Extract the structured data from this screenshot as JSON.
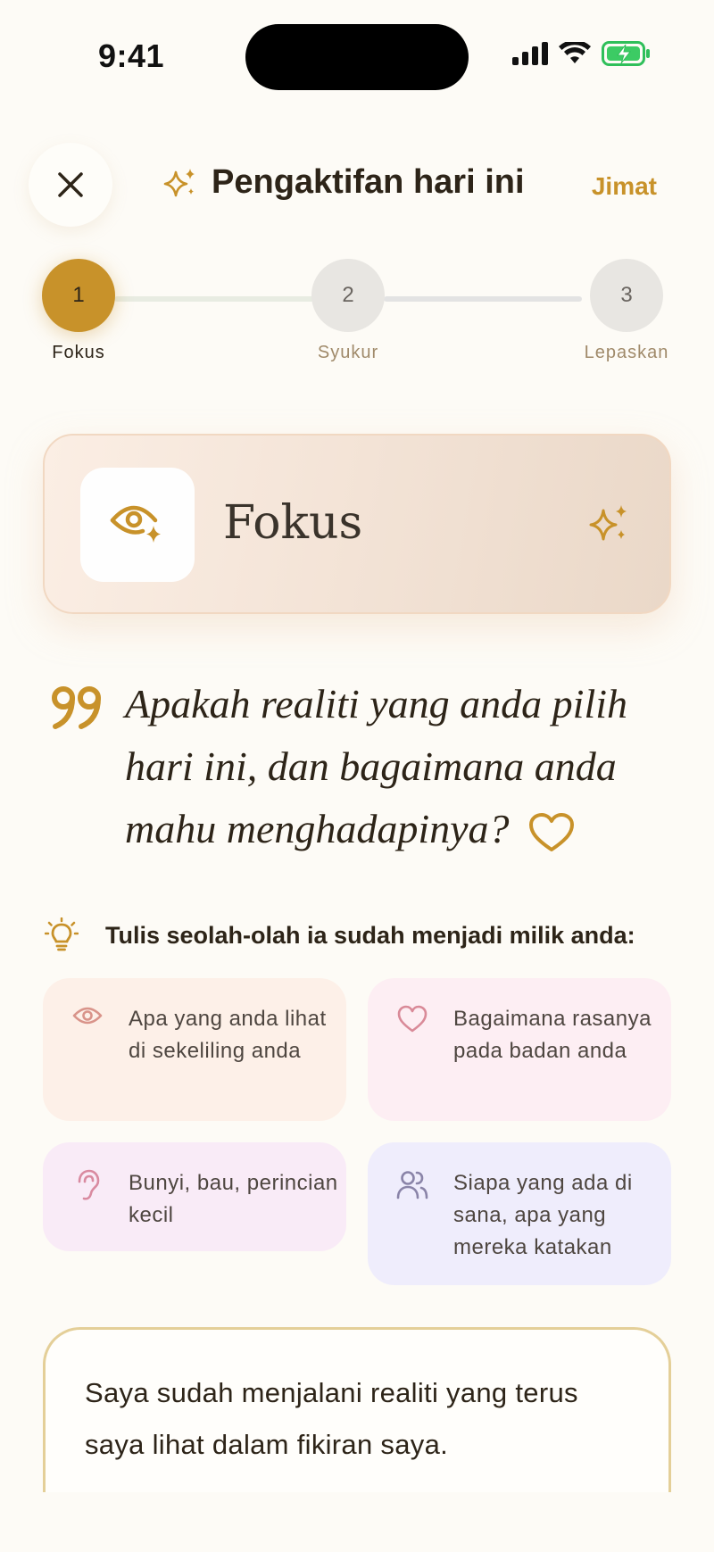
{
  "status_bar": {
    "time": "9:41"
  },
  "header": {
    "title": "Pengaktifan hari ini",
    "save_label": "Jimat"
  },
  "stepper": {
    "steps": [
      {
        "number": "1",
        "label": "Fokus",
        "state": "active"
      },
      {
        "number": "2",
        "label": "Syukur",
        "state": "inactive"
      },
      {
        "number": "3",
        "label": "Lepaskan",
        "state": "inactive"
      }
    ]
  },
  "focus_card": {
    "title": "Fokus"
  },
  "quote": {
    "text": "Apakah realiti yang anda pilih hari ini, dan bagaimana anda mahu menghadapinya?"
  },
  "tip": {
    "text": "Tulis seolah-olah ia sudah menjadi milik anda:"
  },
  "prompts": [
    {
      "icon": "eye-icon",
      "text": "Apa yang anda lihat di sekeliling anda"
    },
    {
      "icon": "heart-icon",
      "text": "Bagaimana rasanya pada badan anda"
    },
    {
      "icon": "ear-icon",
      "text": "Bunyi, bau, perincian kecil"
    },
    {
      "icon": "people-icon",
      "text": "Siapa yang ada di sana, apa yang mereka katakan"
    }
  ],
  "journal": {
    "text": "Saya sudah menjalani realiti yang terus saya lihat dalam fikiran saya."
  },
  "colors": {
    "accent": "#c8922a",
    "background": "#fdfbf6",
    "text": "#2d2418"
  }
}
